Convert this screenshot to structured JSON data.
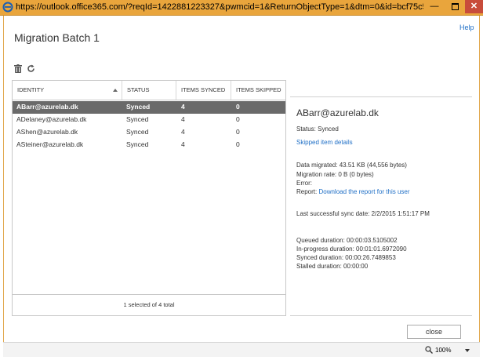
{
  "browser": {
    "url": "https://outlook.office365.com/?reqId=1422881223327&pwmcid=1&ReturnObjectType=1&dtm=0&id=bcf75c5..."
  },
  "dialog": {
    "title": "Migration Batch 1",
    "help_label": "Help",
    "close_label": "close"
  },
  "table": {
    "headers": [
      "IDENTITY",
      "STATUS",
      "ITEMS SYNCED",
      "ITEMS SKIPPED"
    ],
    "rows": [
      {
        "identity": "ABarr@azurelab.dk",
        "status": "Synced",
        "synced": "4",
        "skipped": "0"
      },
      {
        "identity": "ADelaney@azurelab.dk",
        "status": "Synced",
        "synced": "4",
        "skipped": "0"
      },
      {
        "identity": "AShen@azurelab.dk",
        "status": "Synced",
        "synced": "4",
        "skipped": "0"
      },
      {
        "identity": "ASteiner@azurelab.dk",
        "status": "Synced",
        "synced": "4",
        "skipped": "0"
      }
    ],
    "footer": "1 selected of 4 total"
  },
  "detail": {
    "name": "ABarr@azurelab.dk",
    "status": "Status: Synced",
    "skipped_link": "Skipped item details",
    "data_migrated": "Data migrated: 43.51 KB (44,556 bytes)",
    "migration_rate": "Migration rate: 0 B (0 bytes)",
    "error": "Error:",
    "report_label": "Report:",
    "report_link": "Download the report for this user",
    "last_sync": "Last successful sync date: 2/2/2015 1:51:17 PM",
    "queued": "Queued duration: 00:00:03.5105002",
    "in_progress": "In-progress duration: 00:01:01.6972090",
    "synced": "Synced duration: 00:00:26.7489853",
    "stalled": "Stalled duration: 00:00:00"
  },
  "statusbar": {
    "zoom": "100%"
  },
  "colors": {
    "titlebar": "#e9a53c",
    "link": "#1f6fc6",
    "selected_row": "#6a6a6a"
  }
}
